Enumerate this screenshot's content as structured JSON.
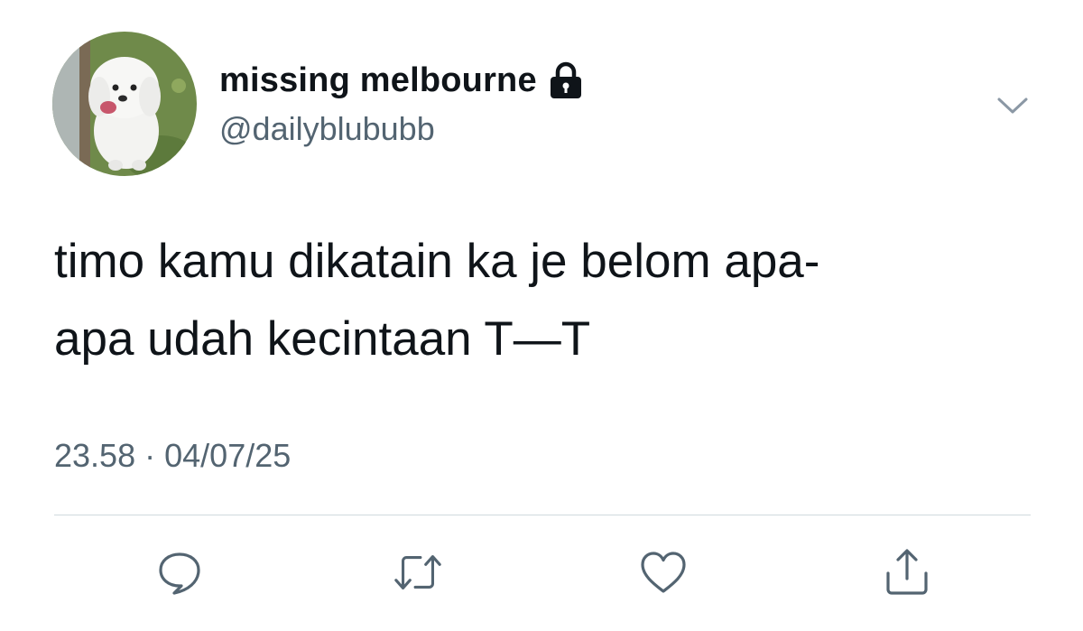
{
  "tweet": {
    "author": {
      "display_name": "missing melbourne",
      "handle": "@dailyblububb",
      "protected_icon": "lock-icon",
      "avatar": "avatar-white-dog"
    },
    "text": "timo kamu dikatain ka je belom apa-\napa udah kecintaan T—T",
    "time": "23.58",
    "separator": "·",
    "date": "04/07/25"
  },
  "actions": [
    {
      "name": "reply",
      "icon": "reply-icon"
    },
    {
      "name": "retweet",
      "icon": "retweet-icon"
    },
    {
      "name": "like",
      "icon": "heart-icon"
    },
    {
      "name": "share",
      "icon": "share-icon"
    }
  ],
  "colors": {
    "text": "#0f1419",
    "secondary": "#536471",
    "divider": "#cfd9de",
    "background": "#ffffff"
  }
}
